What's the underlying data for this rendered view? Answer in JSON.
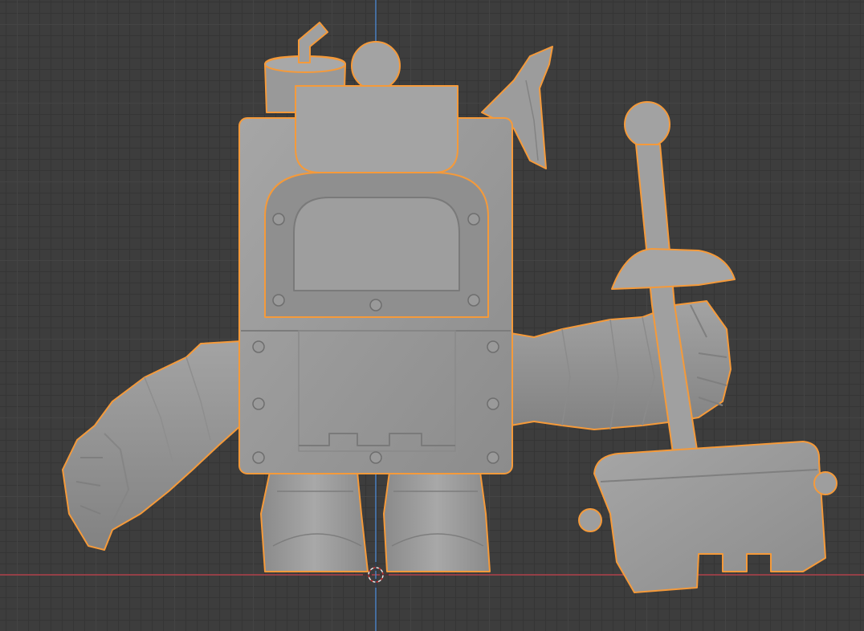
{
  "viewport": {
    "view": "front-orthographic",
    "grid_visible": true,
    "x_axis_color": "#b0404a",
    "z_axis_color": "#4a7fc0",
    "grid_color": "#444444",
    "background_color": "#3d3d3d"
  },
  "model": {
    "selected": true,
    "selection_outline_color": "#f59a3a",
    "material_color": "#9b9b9b",
    "parts": [
      "body",
      "window",
      "hat",
      "antenna",
      "horn",
      "left-arm",
      "right-arm",
      "legs",
      "hammer"
    ]
  },
  "cursor_3d": {
    "icon": "crosshair-icon"
  }
}
